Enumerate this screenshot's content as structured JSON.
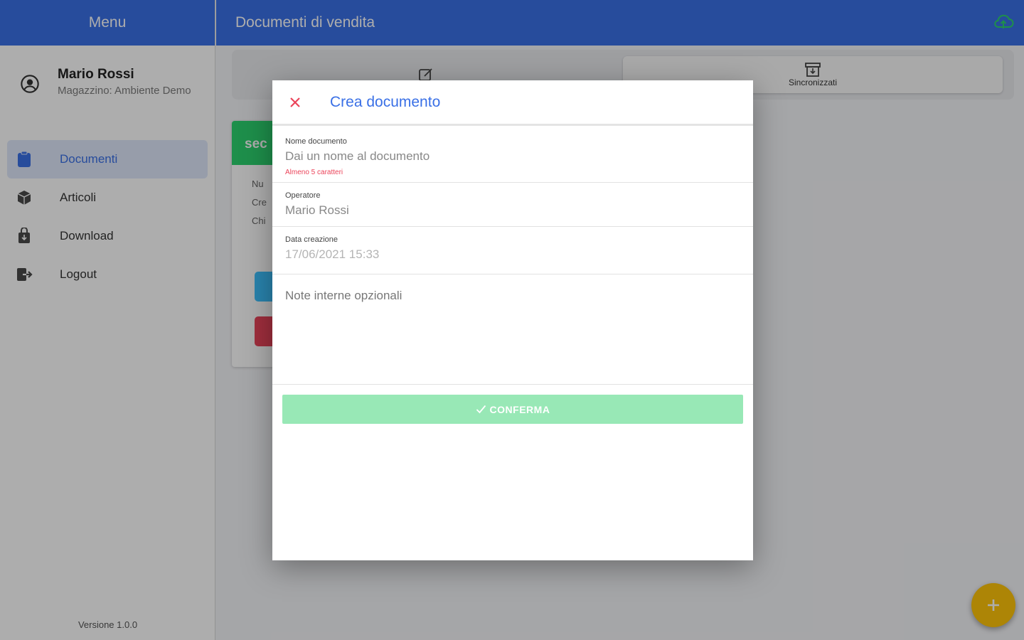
{
  "menu": {
    "title": "Menu",
    "user_name": "Mario Rossi",
    "store": "Magazzino: Ambiente Demo",
    "items": [
      {
        "label": "Documenti",
        "icon": "clipboard-icon",
        "active": true
      },
      {
        "label": "Articoli",
        "icon": "cube-icon",
        "active": false
      },
      {
        "label": "Download",
        "icon": "download-bag-icon",
        "active": false
      },
      {
        "label": "Logout",
        "icon": "logout-icon",
        "active": false
      }
    ],
    "version": "Versione 1.0.0"
  },
  "header": {
    "title": "Documenti di vendita"
  },
  "segments": {
    "right_label": "Sincronizzati"
  },
  "card": {
    "head": "sec",
    "lines": [
      "Nu",
      "Cre",
      "Chi"
    ]
  },
  "modal": {
    "title": "Crea documento",
    "fields": {
      "name_label": "Nome documento",
      "name_placeholder": "Dai un nome al documento",
      "name_hint": "Almeno 5 caratteri",
      "operator_label": "Operatore",
      "operator_value": "Mario Rossi",
      "date_label": "Data creazione",
      "date_value": "17/06/2021 15:33",
      "notes_placeholder": "Note interne opzionali"
    },
    "confirm_label": "CONFERMA"
  },
  "colors": {
    "primary": "#3a70e6",
    "success": "#2dd36f",
    "danger": "#eb445a",
    "warning": "#ffc409",
    "confirm_disabled": "#98e8b6"
  }
}
